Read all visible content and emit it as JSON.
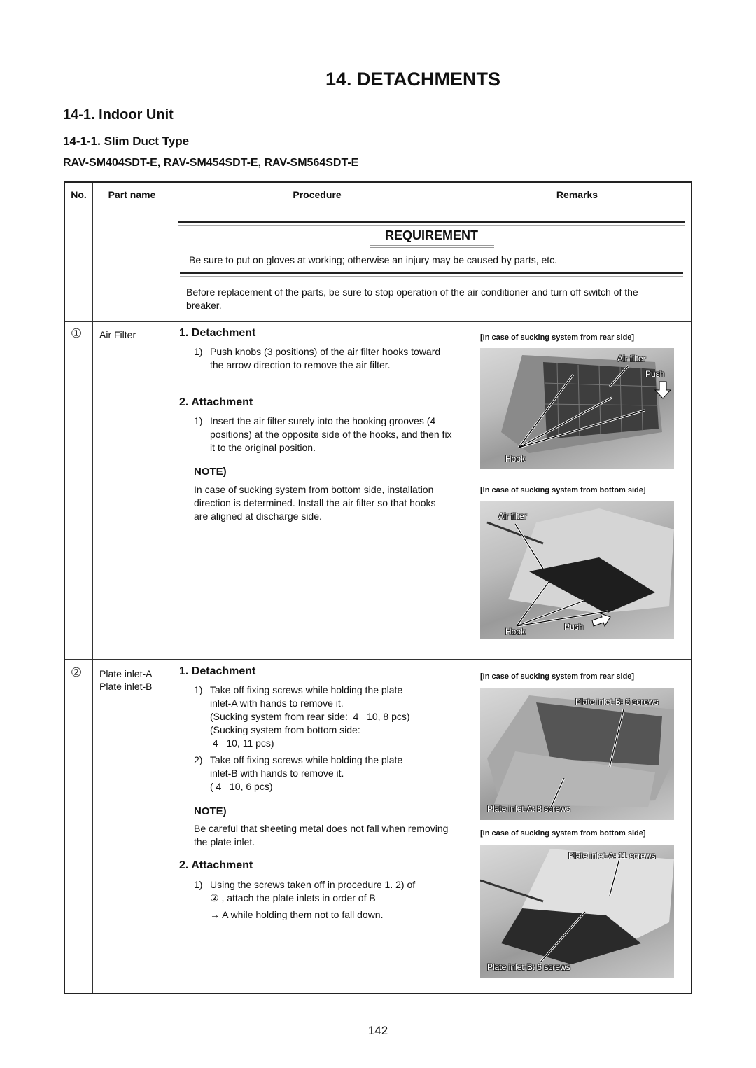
{
  "page": {
    "chapter_title": "14.  DETACHMENTS",
    "section_title": "14-1.   Indoor Unit",
    "subsection_title": "14-1-1.  Slim Duct Type",
    "models": "RAV-SM404SDT-E, RAV-SM454SDT-E, RAV-SM564SDT-E",
    "page_number": "142"
  },
  "table": {
    "headers": {
      "no": "No.",
      "part_name": "Part name",
      "procedure": "Procedure",
      "remarks": "Remarks"
    },
    "requirement": {
      "title": "REQUIREMENT",
      "text": "Be sure to put on gloves at working; otherwise an injury may be caused by parts, etc.",
      "before_text": "Before replacement of the parts, be sure to stop operation of the air conditioner and turn off switch of the breaker."
    },
    "rows": [
      {
        "no": "①",
        "part_name": "Air Filter",
        "detachment": {
          "title": "1. Detachment",
          "steps": [
            {
              "num": "1)",
              "text": "Push knobs (3 positions) of the air filter hooks toward the arrow direction to remove the air filter."
            }
          ]
        },
        "attachment": {
          "title": "2. Attachment",
          "steps": [
            {
              "num": "1)",
              "text": "Insert the air filter surely into the hooking grooves (4 positions) at the opposite side of the hooks, and then fix it to the original position."
            }
          ]
        },
        "note": {
          "title": "NOTE)",
          "text": "In case of sucking system from bottom side, installation direction is determined. Install the air filter so that hooks are aligned at discharge side."
        },
        "remarks": [
          {
            "caption": "[In case of sucking system from rear side]",
            "labels": [
              "Air filter",
              "Push",
              "Hook"
            ]
          },
          {
            "caption": "[In case of sucking system from bottom side]",
            "labels": [
              "Air filter",
              "Hook",
              "Push"
            ]
          }
        ]
      },
      {
        "no": "②",
        "part_name_lines": [
          "Plate inlet-A",
          "Plate inlet-B"
        ],
        "detachment": {
          "title": "1. Detachment",
          "steps": [
            {
              "num": "1)",
              "lines": [
                "Take off fixing screws while holding the plate",
                "inlet-A with hands to remove it.",
                "(Sucking system from rear side:  4   10, 8 pcs)",
                "(Sucking system from bottom side:",
                " 4   10, 11 pcs)"
              ]
            },
            {
              "num": "2)",
              "lines": [
                "Take off fixing screws while holding the plate",
                "inlet-B with hands to remove it.",
                "( 4   10, 6 pcs)"
              ]
            }
          ]
        },
        "note": {
          "title": "NOTE)",
          "text": "Be careful that sheeting metal does not fall when removing the plate inlet."
        },
        "attachment": {
          "title": "2. Attachment",
          "steps": [
            {
              "num": "1)",
              "lines": [
                "Using the screws taken off in procedure 1. 2) of",
                "② , attach the plate inlets in order of B",
                "→ A while holding them not to fall down."
              ]
            }
          ]
        },
        "remarks": [
          {
            "caption": "[In case of sucking system from rear side]",
            "labels": [
              "Plate inlet-B: 6 screws",
              "Plate inlet-A: 8 screws"
            ]
          },
          {
            "caption": "[In case of sucking system from bottom side]",
            "labels": [
              "Plate inlet-A: 11 screws",
              "Plate inlet-B: 6 screws"
            ]
          }
        ]
      }
    ]
  }
}
